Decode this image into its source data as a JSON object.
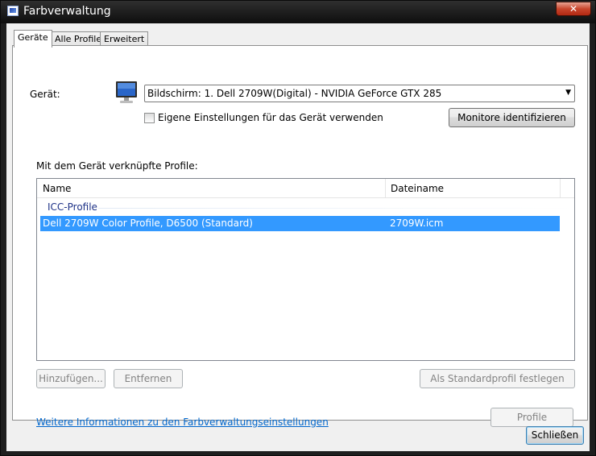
{
  "window": {
    "title": "Farbverwaltung",
    "close_glyph": "✕"
  },
  "tabs": [
    {
      "label": "Geräte",
      "active": true
    },
    {
      "label": "Alle Profile",
      "active": false
    },
    {
      "label": "Erweitert",
      "active": false
    }
  ],
  "device": {
    "label": "Gerät:",
    "selected": "Bildschirm: 1. Dell 2709W(Digital) - NVIDIA GeForce GTX 285",
    "checkbox_label": "Eigene Einstellungen für das Gerät verwenden",
    "checkbox_checked": false,
    "identify_button": "Monitore identifizieren",
    "icon": "monitor-icon"
  },
  "profiles": {
    "section_label": "Mit dem Gerät verknüpfte Profile:",
    "columns": [
      "Name",
      "Dateiname"
    ],
    "group": "ICC-Profile",
    "rows": [
      {
        "name": "Dell 2709W Color Profile, D6500 (Standard)",
        "file": "2709W.icm",
        "selected": true
      }
    ]
  },
  "buttons": {
    "add": "Hinzufügen...",
    "remove": "Entfernen",
    "set_default": "Als Standardprofil festlegen",
    "profile": "Profile",
    "close": "Schließen"
  },
  "link": {
    "more_info": "Weitere Informationen zu den Farbverwaltungseinstellungen"
  },
  "colors": {
    "accent": "#3399ff",
    "link": "#0066cc",
    "group_header": "#1e3287"
  }
}
